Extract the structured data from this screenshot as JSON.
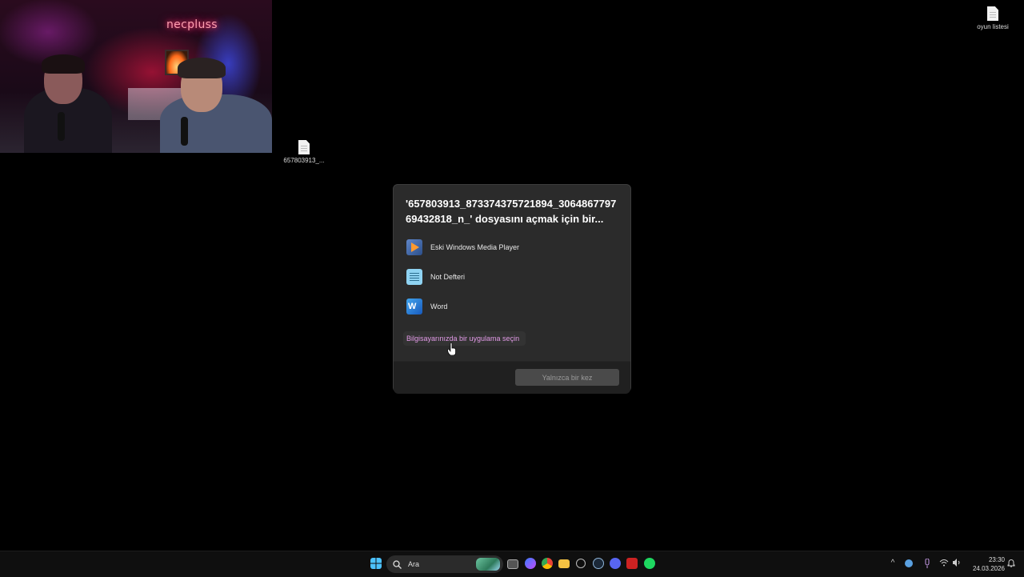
{
  "webcam": {
    "neon_sign": "necpluss"
  },
  "desktop": {
    "icons": [
      {
        "label": "657803913_..."
      },
      {
        "label": "oyun listesi"
      }
    ]
  },
  "dialog": {
    "title": "'657803913_873374375721894_306486779769432818_n_' dosyasını açmak için bir...",
    "apps": [
      {
        "label": "Eski Windows Media Player",
        "icon": "windows-media-player-icon"
      },
      {
        "label": "Not Defteri",
        "icon": "notepad-icon"
      },
      {
        "label": "Word",
        "icon": "word-icon"
      }
    ],
    "choose_link": "Bilgisayarınızda bir uygulama seçin",
    "once_button": "Yalnızca bir kez"
  },
  "taskbar": {
    "search_placeholder": "Ara",
    "time": "23:30",
    "date": "24.03.2026",
    "pinned": [
      "start-icon",
      "task-view-icon",
      "copilot-icon",
      "chrome-icon",
      "file-explorer-icon",
      "clock-app-icon",
      "steam-icon",
      "discord-icon",
      "game-launcher-icon",
      "spotify-icon"
    ]
  },
  "colors": {
    "link": "#e39be8",
    "dialog_bg": "#2b2b2b",
    "taskbar_bg": "#0f0f0f"
  }
}
